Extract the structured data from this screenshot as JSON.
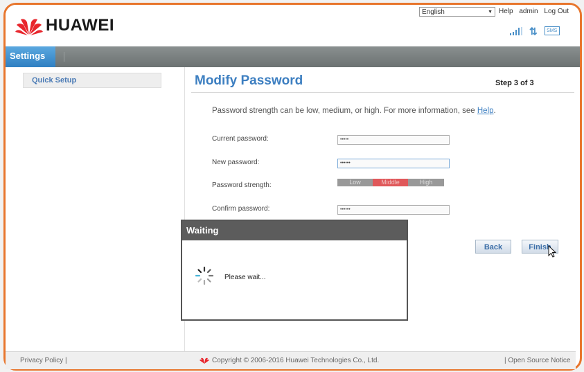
{
  "header": {
    "brand": "HUAWEI",
    "language": "English",
    "links": [
      "Help",
      "admin",
      "Log Out"
    ],
    "icons": [
      "signal-icon",
      "data-transfer-icon",
      "sms-icon"
    ]
  },
  "nav": {
    "tab": "Settings"
  },
  "sidebar": {
    "items": [
      {
        "label": "Quick Setup"
      }
    ]
  },
  "main": {
    "title": "Modify Password",
    "step": "Step 3 of 3",
    "info": "Password strength can be low, medium, or high. For more information, see ",
    "info_link": "Help",
    "info_tail": ".",
    "fields": {
      "current_label": "Current password:",
      "current_value": "•••••",
      "new_label": "New password:",
      "new_value": "••••••",
      "strength_label": "Password strength:",
      "confirm_label": "Confirm password:",
      "confirm_value": "••••••"
    },
    "strength": {
      "low": "Low",
      "middle": "Middle",
      "high": "High",
      "level": "Middle"
    },
    "buttons": {
      "back": "Back",
      "finish": "Finish"
    }
  },
  "dialog": {
    "title": "Waiting",
    "message": "Please wait..."
  },
  "footer": {
    "privacy": "Privacy Policy",
    "copyright": "Copyright © 2006-2016 Huawei Technologies Co., Ltd.",
    "open_source": "Open Source Notice"
  },
  "colors": {
    "accent": "#3d7fc1",
    "frame": "#e8762d",
    "strength_middle": "#e0585a"
  }
}
